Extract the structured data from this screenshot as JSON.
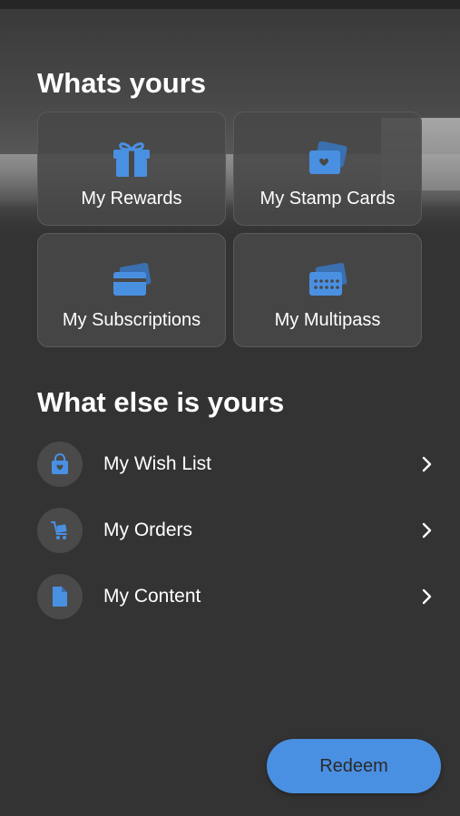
{
  "colors": {
    "accent": "#4a90e2",
    "background": "#333333",
    "tile": "#484848"
  },
  "whats_yours": {
    "title": "Whats yours",
    "tiles": [
      {
        "label": "My Rewards",
        "icon": "gift-icon"
      },
      {
        "label": "My Stamp Cards",
        "icon": "stamp-card-icon"
      },
      {
        "label": "My Subscriptions",
        "icon": "subscription-card-icon"
      },
      {
        "label": "My Multipass",
        "icon": "multipass-card-icon"
      }
    ]
  },
  "what_else": {
    "title": "What else is yours",
    "items": [
      {
        "label": "My Wish List",
        "icon": "shopping-bag-icon"
      },
      {
        "label": "My Orders",
        "icon": "cart-icon"
      },
      {
        "label": "My Content",
        "icon": "document-icon"
      }
    ]
  },
  "redeem": {
    "label": "Redeem"
  }
}
